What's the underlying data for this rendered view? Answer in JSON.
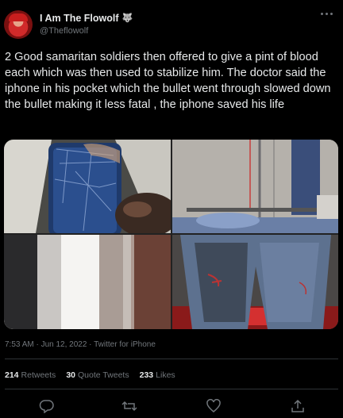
{
  "tweet": {
    "display_name": "I Am The Flowolf",
    "name_emoji": "🐺",
    "handle": "@Theflowolf",
    "text": "2 Good samaritan soldiers then offered to give a pint of blood each which was then used to stabilize him. The doctor said the iphone in his pocket which the bullet went through slowed down the bullet making it less fatal , the iphone saved his life",
    "timestamp": "7:53 AM · Jun 12, 2022 · Twitter for iPhone"
  },
  "stats": {
    "retweets_count": "214",
    "retweets_label": "Retweets",
    "quote_count": "30",
    "quote_label": "Quote Tweets",
    "likes_count": "233",
    "likes_label": "Likes"
  },
  "actions": [
    "reply-icon",
    "retweet-icon",
    "like-icon",
    "share-icon"
  ],
  "colors": {
    "background": "#000000",
    "text": "#e7e9ea",
    "muted": "#71767b",
    "divider": "#2f3336"
  }
}
